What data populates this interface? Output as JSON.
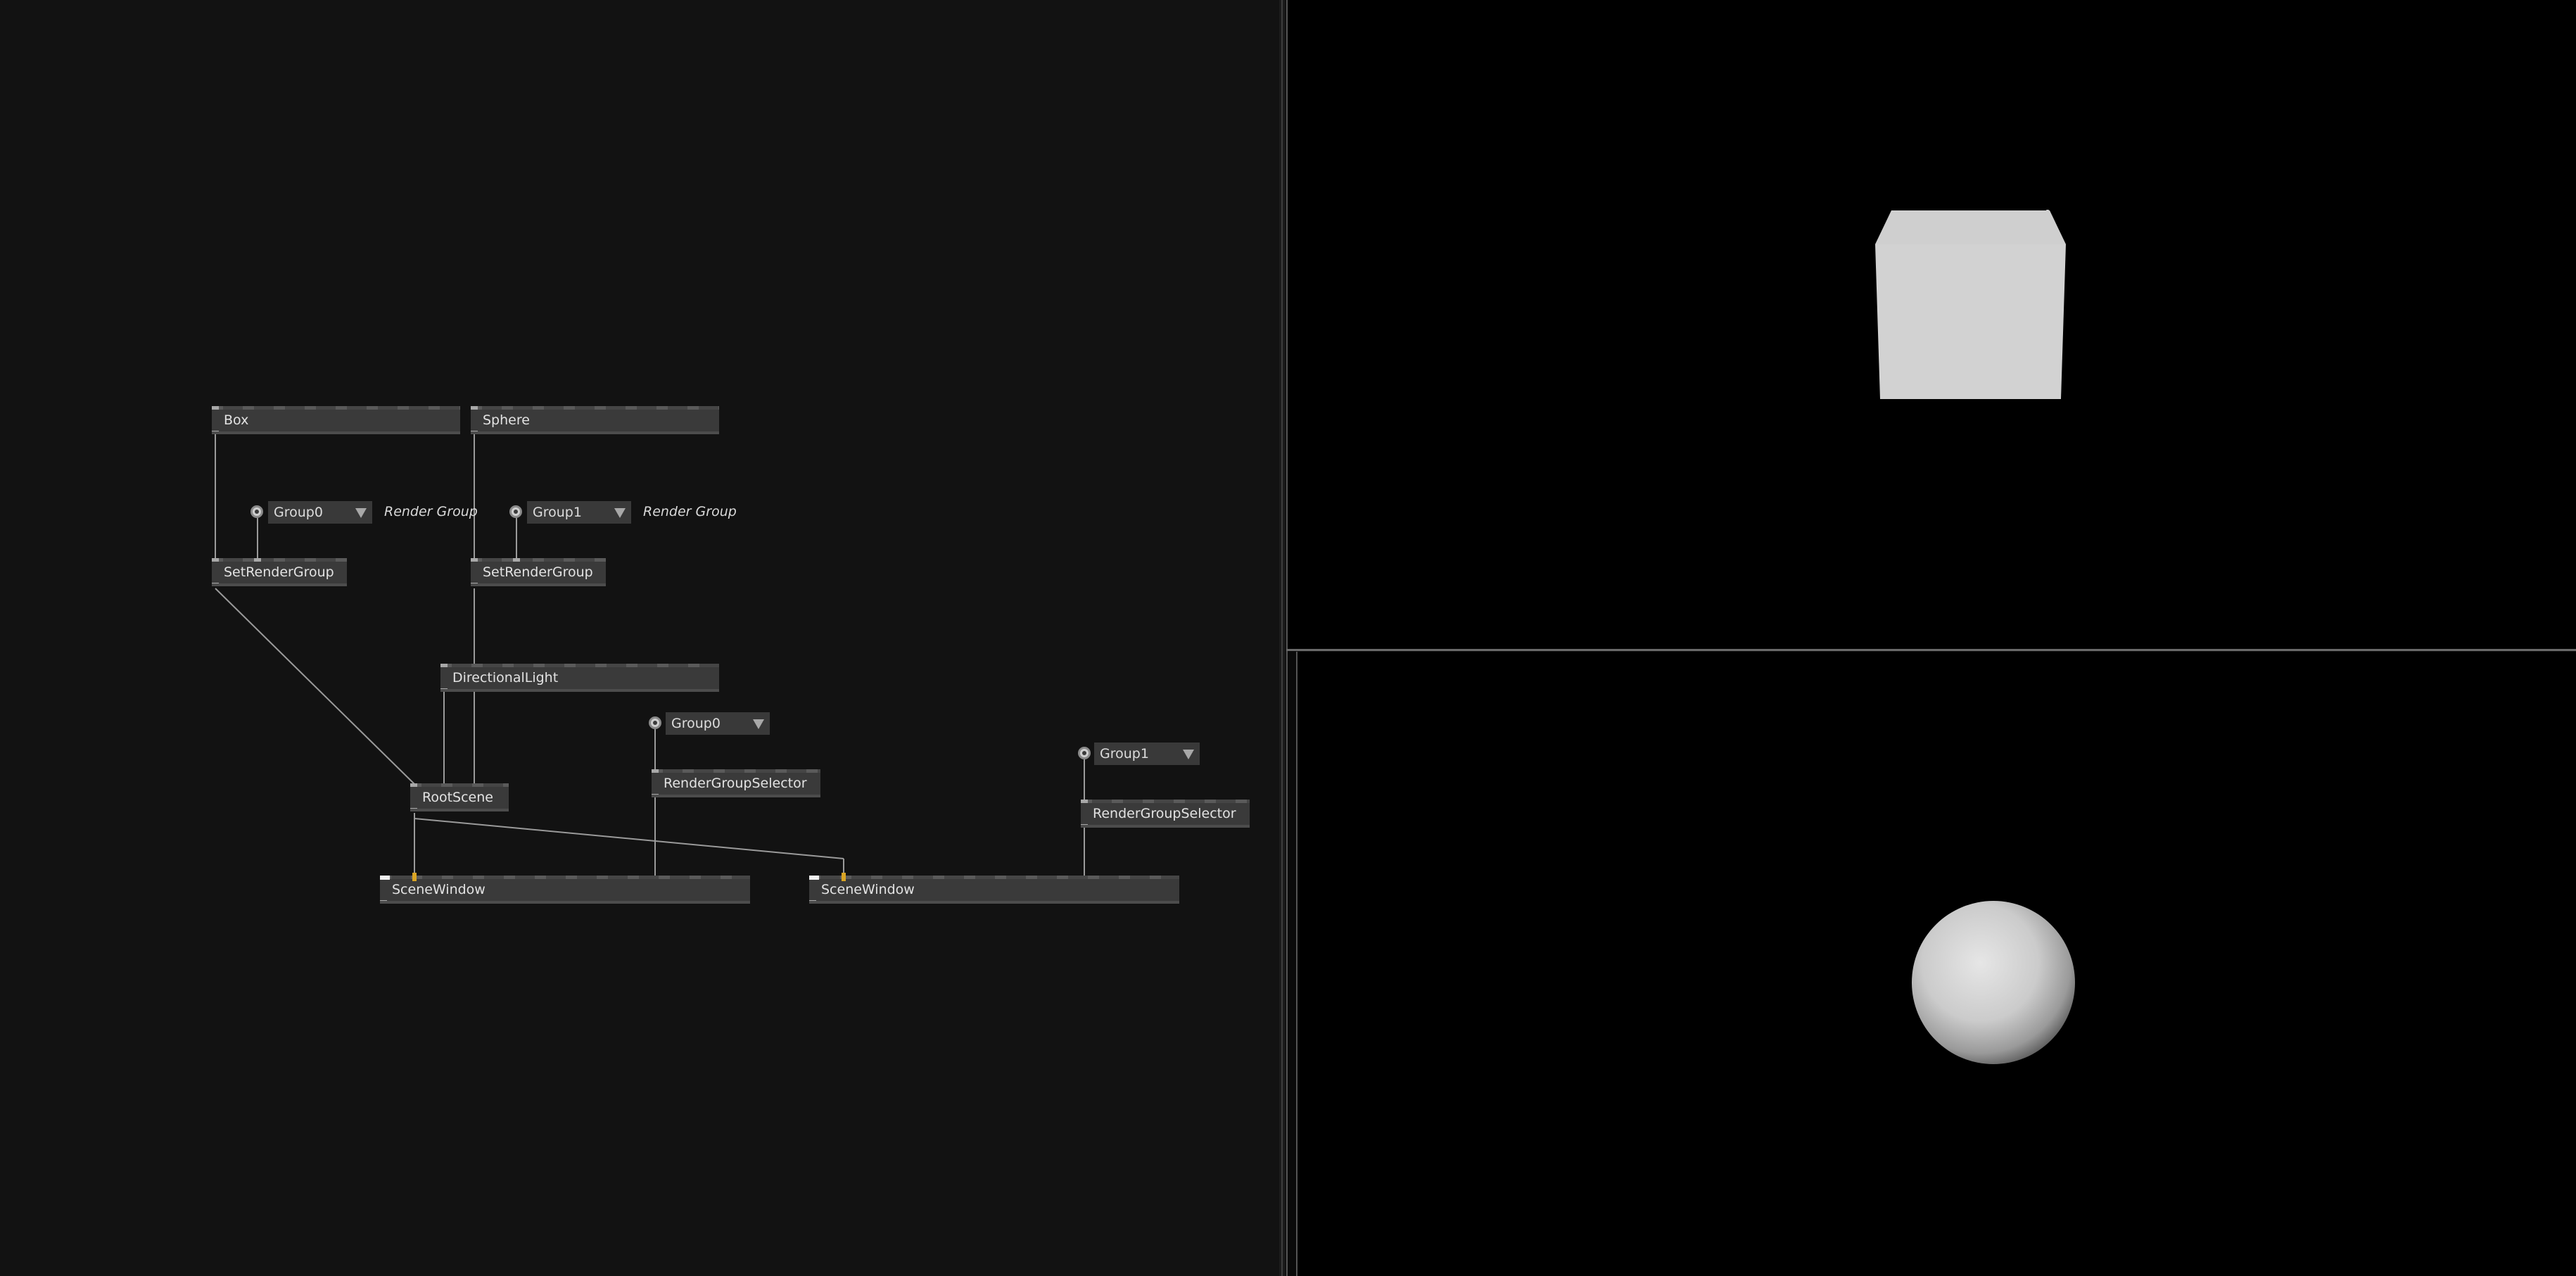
{
  "nodes": {
    "box": {
      "label": "Box"
    },
    "sphere": {
      "label": "Sphere"
    },
    "set_render_group_0": {
      "label": "SetRenderGroup"
    },
    "set_render_group_1": {
      "label": "SetRenderGroup"
    },
    "directional_light": {
      "label": "DirectionalLight"
    },
    "root_scene": {
      "label": "RootScene"
    },
    "render_group_selector_0": {
      "label": "RenderGroupSelector"
    },
    "render_group_selector_1": {
      "label": "RenderGroupSelector"
    },
    "scene_window_0": {
      "label": "SceneWindow"
    },
    "scene_window_1": {
      "label": "SceneWindow"
    }
  },
  "params": {
    "set_group_0": {
      "value": "Group0",
      "label": "Render Group"
    },
    "set_group_1": {
      "value": "Group1",
      "label": "Render Group"
    },
    "selector_0": {
      "value": "Group0"
    },
    "selector_1": {
      "value": "Group1"
    }
  },
  "colors": {
    "graph_bg": "#121212",
    "node_bg": "#3a3a3a",
    "wire": "#9a9a9a",
    "pin_accent": "#d9a424",
    "viewport_bg": "#000000",
    "object": "#d4d4d4"
  },
  "viewports": {
    "top": {
      "object": "box"
    },
    "bottom": {
      "object": "sphere"
    }
  }
}
